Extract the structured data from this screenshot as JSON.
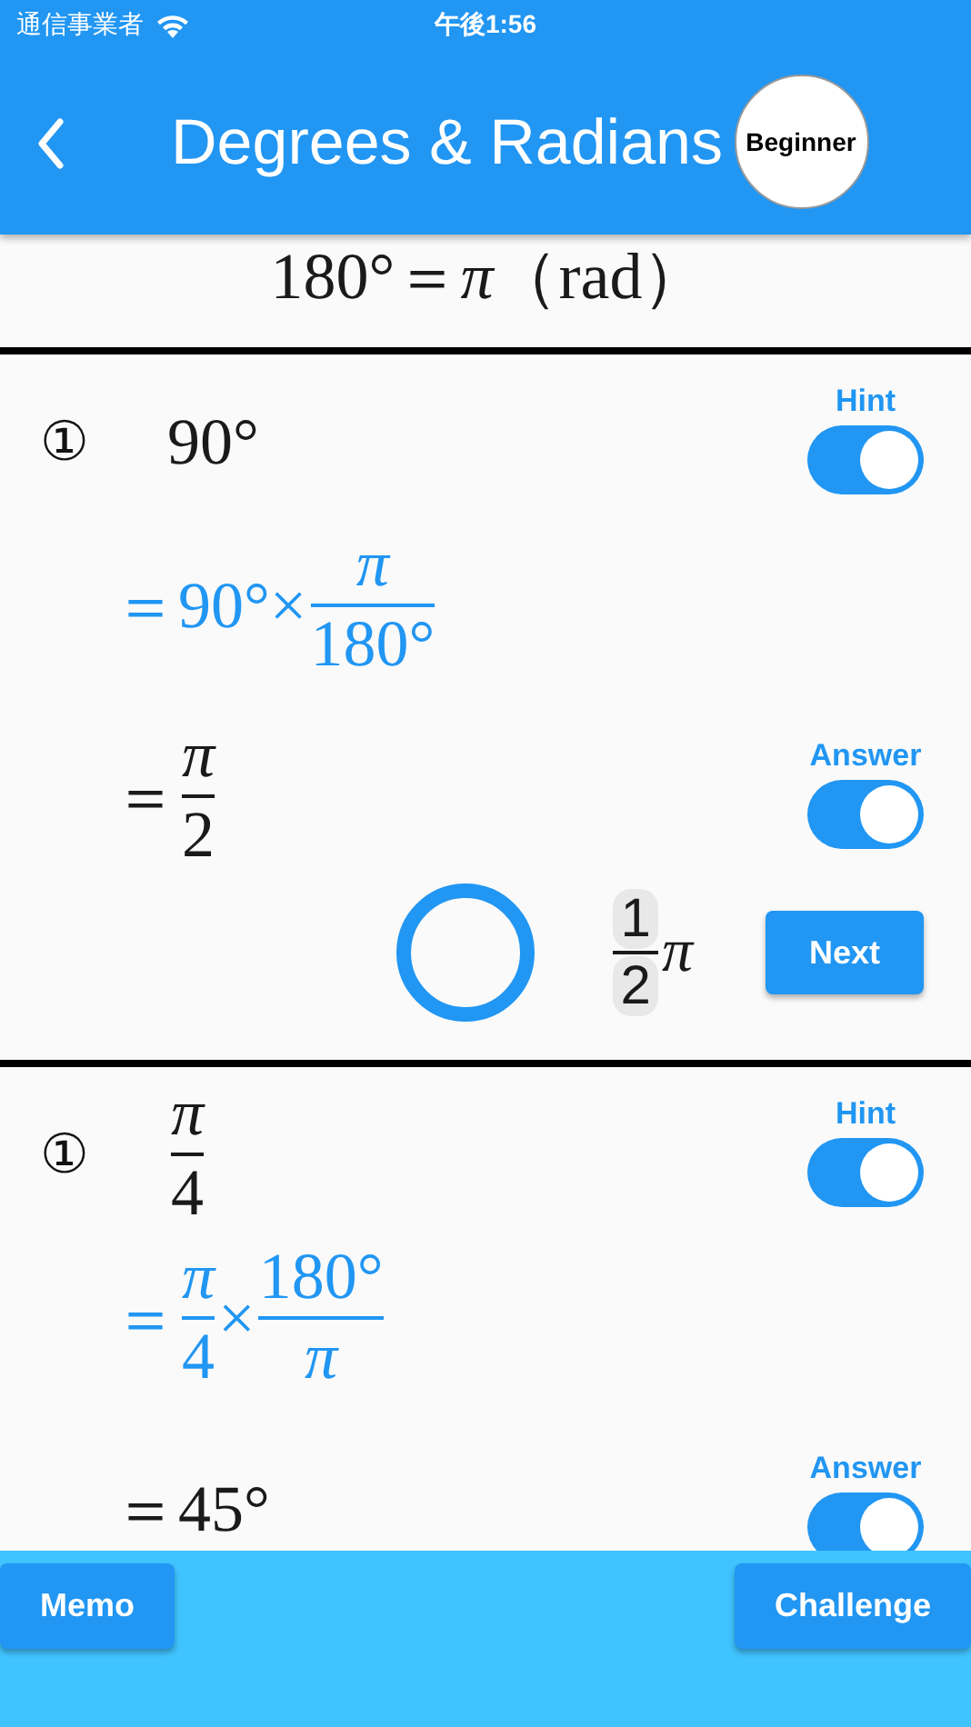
{
  "status_bar": {
    "carrier": "通信事業者",
    "time": "午後1:56"
  },
  "app_bar": {
    "title": "Degrees & Radians",
    "badge": "Beginner"
  },
  "formula": "180°＝*π*（rad）",
  "problems": [
    {
      "number": "①",
      "question": [
        {
          "kind": "text",
          "text": "90°"
        }
      ],
      "hint": {
        "label": "Hint",
        "on": true
      },
      "hint_step": {
        "kind": "hint",
        "parts": [
          {
            "kind": "text",
            "text": "＝90°×"
          },
          {
            "kind": "fraction",
            "numerator": {
              "text": "π",
              "italic": true
            },
            "denominator": {
              "text": "180°"
            }
          }
        ]
      },
      "answer": {
        "label": "Answer",
        "on": true
      },
      "answer_step": {
        "kind": "answer",
        "parts": [
          {
            "kind": "text",
            "text": "＝"
          },
          {
            "kind": "fraction",
            "numerator": {
              "text": "π",
              "italic": true
            },
            "denominator": {
              "text": "2"
            }
          }
        ]
      },
      "result": {
        "kind": "correct",
        "numerator": "1",
        "denominator": "2",
        "suffix": "π",
        "button": "Next"
      }
    },
    {
      "number": "①",
      "question": [
        {
          "kind": "fraction",
          "numerator": {
            "text": "π",
            "italic": true
          },
          "denominator": {
            "text": "4"
          }
        }
      ],
      "hint": {
        "label": "Hint",
        "on": true
      },
      "hint_step": {
        "kind": "hint",
        "parts": [
          {
            "kind": "text",
            "text": "＝"
          },
          {
            "kind": "fraction",
            "numerator": {
              "text": "π",
              "italic": true
            },
            "denominator": {
              "text": "4"
            }
          },
          {
            "kind": "text",
            "text": "×"
          },
          {
            "kind": "fraction",
            "numerator": {
              "text": "180°"
            },
            "denominator": {
              "text": "π",
              "italic": true
            }
          }
        ]
      },
      "answer": {
        "label": "Answer",
        "on": true
      },
      "answer_step": {
        "kind": "answer",
        "parts": [
          {
            "kind": "text",
            "text": "＝45°"
          }
        ]
      }
    }
  ],
  "bottom_bar": {
    "left_button": "Memo",
    "right_button": "Challenge"
  }
}
